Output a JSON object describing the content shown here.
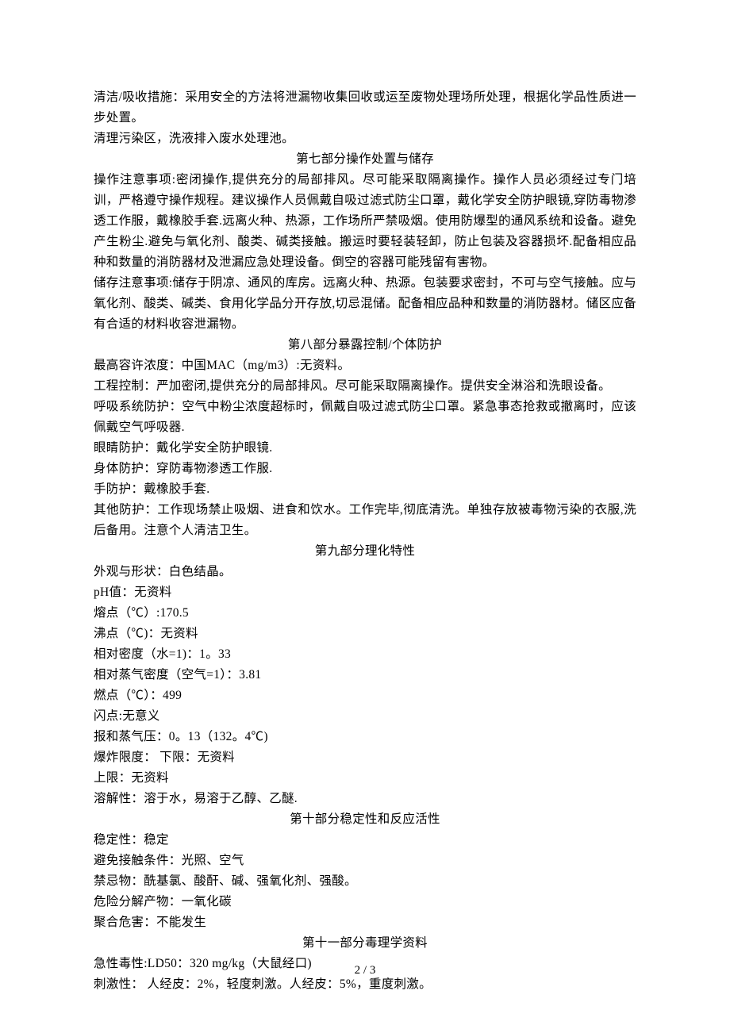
{
  "p1": "清洁/吸收措施：采用安全的方法将泄漏物收集回收或运至废物处理场所处理，根据化学品性质进一步处置。",
  "p2": "清理污染区，洗液排入废水处理池。",
  "h7": "第七部分操作处置与储存",
  "p3": "操作注意事项:密闭操作,提供充分的局部排风。尽可能采取隔离操作。操作人员必须经过专门培训，严格遵守操作规程。建议操作人员佩戴自吸过滤式防尘口罩，戴化学安全防护眼镜,穿防毒物渗透工作服，戴橡胶手套.远离火种、热源，工作场所严禁吸烟。使用防爆型的通风系统和设备。避免产生粉尘.避免与氧化剂、酸类、碱类接触。搬运时要轻装轻卸，防止包装及容器损坏.配备相应品种和数量的消防器材及泄漏应急处理设备。倒空的容器可能残留有害物。",
  "p4": "储存注意事项:储存于阴凉、通风的库房。远离火种、热源。包装要求密封，不可与空气接触。应与氧化剂、酸类、碱类、食用化学品分开存放,切忌混储。配备相应品种和数量的消防器材。储区应备有合适的材料收容泄漏物。",
  "h8": "第八部分暴露控制/个体防护",
  "p5": "最高容许浓度：中国MAC（mg/m3）:无资料。",
  "p6": "工程控制：严加密闭,提供充分的局部排风。尽可能采取隔离操作。提供安全淋浴和洗眼设备。",
  "p7": "呼吸系统防护：空气中粉尘浓度超标时，佩戴自吸过滤式防尘口罩。紧急事态抢救或撤离时，应该佩戴空气呼吸器.",
  "p8": "眼睛防护：戴化学安全防护眼镜.",
  "p9": "身体防护：穿防毒物渗透工作服.",
  "p10": "手防护：戴橡胶手套.",
  "p11": "其他防护：工作现场禁止吸烟、进食和饮水。工作完毕,彻底清洗。单独存放被毒物污染的衣服,洗后备用。注意个人清洁卫生。",
  "h9": "第九部分理化特性",
  "p12": "外观与形状：白色结晶。",
  "p13": "pH值：无资料",
  "p14": "熔点（℃）:170.5",
  "p15": "沸点（℃)：无资料",
  "p16": "相对密度（水=1)：1。33",
  "p17": "相对蒸气密度（空气=1）：3.81",
  "p18": "燃点（℃）：499",
  "p19": "闪点:无意义",
  "p20": "报和蒸气压：0。13（132。4℃)",
  "p21": "爆炸限度：  下限：无资料",
  "p22": "上限：无资料",
  "p23": "溶解性：溶于水，易溶于乙醇、乙醚.",
  "h10": "第十部分稳定性和反应活性",
  "p24": "稳定性：稳定",
  "p25": "避免接触条件：光照、空气",
  "p26": "禁忌物：酰基氯、酸酐、碱、强氧化剂、强酸。",
  "p27": "危险分解产物：一氧化碳",
  "p28": "聚合危害：不能发生",
  "h11": "第十一部分毒理学资料",
  "p29": "急性毒性:LD50：320 mg/kg（大鼠经口)",
  "p30": "刺激性：  人经皮：2%，轻度刺激。人经皮：5%，重度刺激。",
  "footer": "2 / 3"
}
